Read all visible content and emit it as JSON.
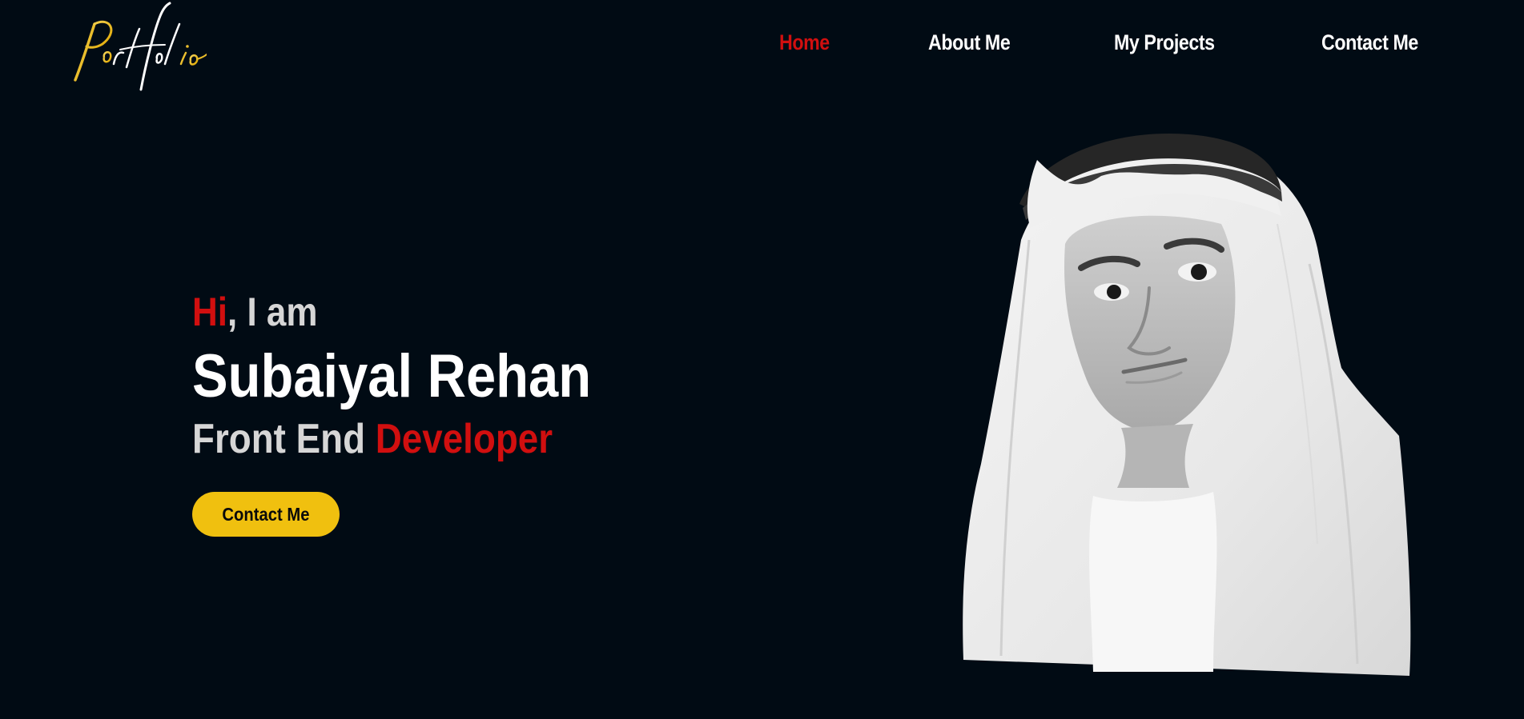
{
  "logo": {
    "text": "Portfolio",
    "colors": {
      "gold": "#f0c00f",
      "white": "#ffffff"
    }
  },
  "nav": {
    "items": [
      {
        "label": "Home",
        "active": true
      },
      {
        "label": "About Me",
        "active": false
      },
      {
        "label": "My Projects",
        "active": false
      },
      {
        "label": "Contact Me",
        "active": false
      }
    ]
  },
  "hero": {
    "greeting_accent": "Hi",
    "greeting_rest": ", I am",
    "name": "Subaiyal Rehan",
    "role_prefix": "Front End ",
    "role_accent": "Developer",
    "cta_label": "Contact Me"
  },
  "theme": {
    "background": "#010b14",
    "accent_red": "#d10f0f",
    "accent_yellow": "#f0c00f",
    "text_light": "#d6d6d6",
    "text_white": "#ffffff"
  },
  "portrait": {
    "icon": "profile-photo",
    "style": "grayscale cutout"
  }
}
